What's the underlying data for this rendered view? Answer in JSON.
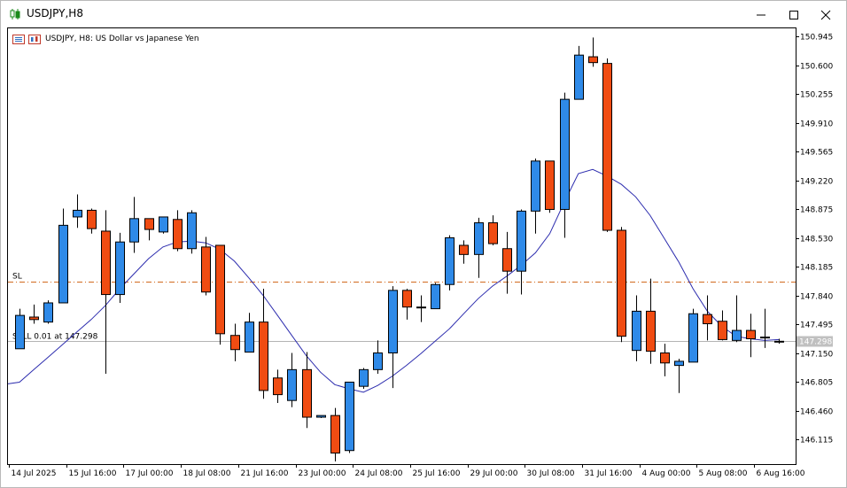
{
  "window": {
    "title": "USDJPY,H8",
    "buttons": {
      "minimize": "minimize",
      "maximize": "maximize",
      "close": "close"
    }
  },
  "legend": {
    "text": "USDJPY, H8:  US Dollar vs Japanese Yen",
    "icons": [
      "market-watch-icon",
      "chart-properties-icon"
    ]
  },
  "colors": {
    "bull": "#2f8ae8",
    "bear": "#f04c12",
    "ma": "#2c2cae",
    "sl_line": "#d2691e",
    "price_line": "#b4b4b4",
    "grid_border": "#000000"
  },
  "chart_data": {
    "type": "candlestick",
    "symbol": "USDJPY",
    "timeframe": "H8",
    "ylim": [
      145.85,
      151.07
    ],
    "price_ticks": [
      "150.945",
      "150.600",
      "150.255",
      "149.910",
      "149.565",
      "149.220",
      "148.875",
      "148.530",
      "148.185",
      "147.840",
      "147.495",
      "147.150",
      "146.805",
      "146.460",
      "146.115"
    ],
    "time_labels": [
      "14 Jul 2025",
      "15 Jul 16:00",
      "17 Jul 00:00",
      "18 Jul 08:00",
      "21 Jul 16:00",
      "23 Jul 00:00",
      "24 Jul 08:00",
      "25 Jul 16:00",
      "29 Jul 00:00",
      "30 Jul 08:00",
      "31 Jul 16:00",
      "4 Aug 00:00",
      "5 Aug 08:00",
      "6 Aug 16:00"
    ],
    "time_label_indices": [
      0,
      4,
      8,
      12,
      16,
      20,
      24,
      28,
      32,
      36,
      40,
      44,
      48,
      52
    ],
    "candles": [
      [
        147.2,
        147.6,
        147.2,
        147.68
      ],
      [
        147.58,
        147.55,
        147.5,
        147.73
      ],
      [
        147.52,
        147.75,
        147.5,
        147.78
      ],
      [
        147.75,
        148.68,
        147.75,
        148.88
      ],
      [
        148.78,
        148.86,
        148.65,
        149.05
      ],
      [
        148.86,
        148.64,
        148.58,
        148.88
      ],
      [
        148.61,
        147.85,
        146.9,
        148.86
      ],
      [
        147.85,
        148.48,
        147.75,
        148.59
      ],
      [
        148.48,
        148.76,
        148.35,
        149.02
      ],
      [
        148.76,
        148.63,
        148.5,
        148.76
      ],
      [
        148.6,
        148.78,
        148.58,
        148.76
      ],
      [
        148.75,
        148.4,
        148.37,
        148.86
      ],
      [
        148.4,
        148.83,
        148.34,
        148.86
      ],
      [
        148.42,
        147.88,
        147.84,
        148.54
      ],
      [
        148.44,
        147.38,
        147.25,
        148.44
      ],
      [
        147.36,
        147.19,
        147.05,
        147.5
      ],
      [
        147.16,
        147.52,
        147.16,
        147.63
      ],
      [
        147.52,
        146.7,
        146.6,
        147.92
      ],
      [
        146.85,
        146.65,
        146.55,
        146.95
      ],
      [
        146.58,
        146.95,
        146.5,
        147.15
      ],
      [
        146.95,
        146.38,
        146.25,
        147.16
      ],
      [
        146.38,
        146.4,
        146.37,
        146.4
      ],
      [
        146.4,
        145.95,
        145.85,
        146.49
      ],
      [
        145.98,
        146.8,
        145.95,
        146.8
      ],
      [
        146.75,
        146.95,
        146.72,
        146.97
      ],
      [
        146.95,
        147.15,
        146.9,
        147.3
      ],
      [
        147.15,
        147.9,
        146.73,
        147.95
      ],
      [
        147.9,
        147.7,
        147.55,
        147.92
      ],
      [
        147.7,
        147.7,
        147.52,
        147.84
      ],
      [
        147.68,
        147.97,
        147.68,
        147.99
      ],
      [
        147.97,
        148.53,
        147.9,
        148.56
      ],
      [
        148.44,
        148.33,
        148.22,
        148.5
      ],
      [
        148.33,
        148.71,
        148.05,
        148.77
      ],
      [
        148.71,
        148.46,
        148.44,
        148.8
      ],
      [
        148.4,
        148.13,
        147.86,
        148.6
      ],
      [
        148.13,
        148.85,
        147.85,
        148.87
      ],
      [
        148.85,
        149.45,
        148.58,
        149.48
      ],
      [
        149.45,
        148.87,
        148.83,
        149.45
      ],
      [
        148.87,
        150.19,
        148.53,
        150.27
      ],
      [
        150.19,
        150.72,
        150.19,
        150.83
      ],
      [
        150.7,
        150.63,
        150.58,
        150.93
      ],
      [
        150.62,
        148.62,
        148.6,
        150.68
      ],
      [
        148.62,
        147.35,
        147.28,
        148.66
      ],
      [
        147.18,
        147.65,
        147.05,
        147.84
      ],
      [
        147.65,
        147.17,
        147.02,
        148.04
      ],
      [
        147.15,
        147.03,
        146.87,
        147.26
      ],
      [
        147.0,
        147.05,
        146.67,
        147.08
      ],
      [
        147.04,
        147.62,
        147.04,
        147.68
      ],
      [
        147.61,
        147.5,
        147.3,
        147.84
      ],
      [
        147.53,
        147.31,
        147.3,
        147.66
      ],
      [
        147.3,
        147.42,
        147.28,
        147.84
      ],
      [
        147.42,
        147.32,
        147.1,
        147.62
      ],
      [
        147.34,
        147.33,
        147.21,
        147.68
      ],
      [
        147.29,
        147.29,
        147.26,
        147.32
      ]
    ],
    "ma": [
      146.8,
      146.95,
      147.1,
      147.25,
      147.4,
      147.55,
      147.72,
      147.92,
      148.1,
      148.28,
      148.42,
      148.48,
      148.49,
      148.47,
      148.39,
      148.25,
      148.05,
      147.84,
      147.6,
      147.36,
      147.12,
      146.92,
      146.77,
      146.72,
      146.68,
      146.76,
      146.87,
      147.0,
      147.14,
      147.29,
      147.44,
      147.62,
      147.8,
      147.95,
      148.07,
      148.2,
      148.35,
      148.58,
      148.95,
      149.3,
      149.35,
      149.27,
      149.17,
      149.02,
      148.8,
      148.52,
      148.24,
      147.92,
      147.65,
      147.47,
      147.35,
      147.32,
      147.3,
      147.31
    ],
    "sl_level": 148.0,
    "sl_label": "SL",
    "order_price": 147.298,
    "order_label": "SELL 0.01 at 147.298",
    "price_tag": "147.298"
  }
}
